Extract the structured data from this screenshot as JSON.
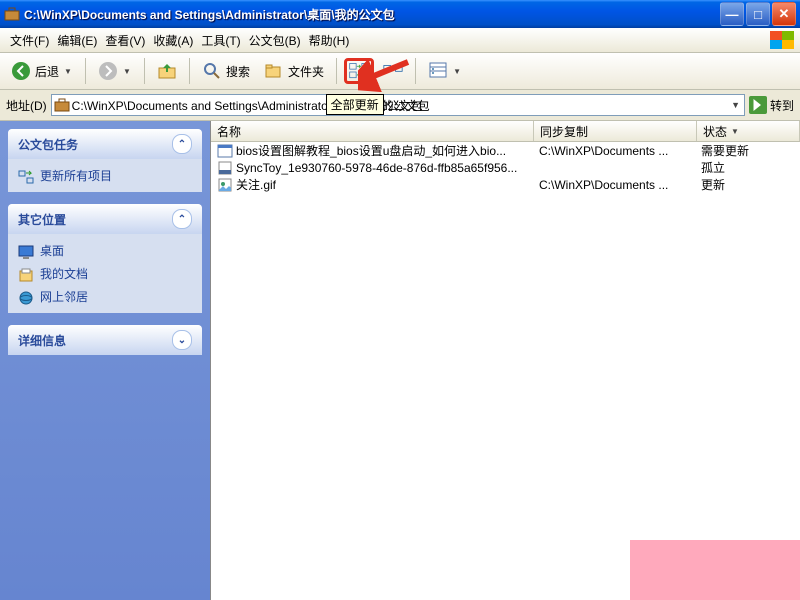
{
  "window": {
    "title": "C:\\WinXP\\Documents and Settings\\Administrator\\桌面\\我的公文包"
  },
  "menu": {
    "file": "文件(F)",
    "edit": "编辑(E)",
    "view": "查看(V)",
    "favorites": "收藏(A)",
    "tools": "工具(T)",
    "briefcase": "公文包(B)",
    "help": "帮助(H)"
  },
  "toolbar": {
    "back": "后退",
    "search": "搜索",
    "folders": "文件夹"
  },
  "tooltip": {
    "update_all": "全部更新"
  },
  "address": {
    "label": "地址(D)",
    "path": "C:\\WinXP\\Documents and Settings\\Administrator\\桌面\\我的公文包",
    "trailing": "的公文包",
    "go": "转到"
  },
  "sidebar": {
    "tasks": {
      "title": "公文包任务",
      "items": [
        {
          "icon": "sync",
          "label": "更新所有项目"
        }
      ]
    },
    "other": {
      "title": "其它位置",
      "items": [
        {
          "icon": "desktop",
          "label": "桌面"
        },
        {
          "icon": "mydocs",
          "label": "我的文档"
        },
        {
          "icon": "network",
          "label": "网上邻居"
        }
      ]
    },
    "details": {
      "title": "详细信息"
    }
  },
  "columns": {
    "name": "名称",
    "sync": "同步复制",
    "status": "状态",
    "w_name": 310,
    "w_sync": 150,
    "w_status": 90
  },
  "files": [
    {
      "icon": "htm",
      "name": "bios设置图解教程_bios设置u盘启动_如何进入bio...",
      "sync": "C:\\WinXP\\Documents ...",
      "status": "需要更新"
    },
    {
      "icon": "dat",
      "name": "SyncToy_1e930760-5978-46de-876d-ffb85a65f956...",
      "sync": "",
      "status": "孤立"
    },
    {
      "icon": "gif",
      "name": "关注.gif",
      "sync": "C:\\WinXP\\Documents ...",
      "status": "更新"
    }
  ]
}
